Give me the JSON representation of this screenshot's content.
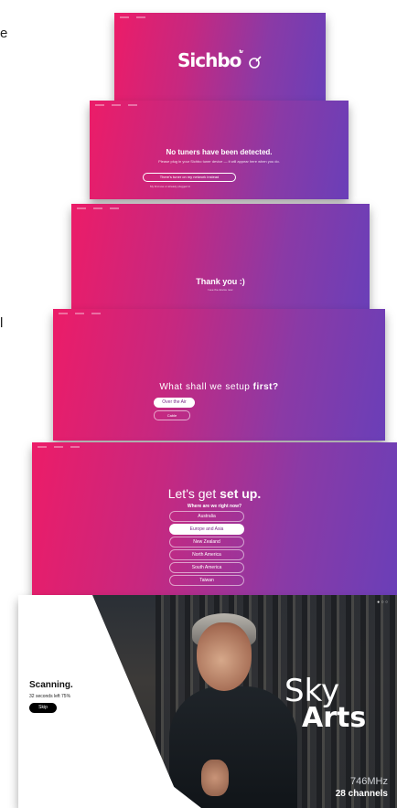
{
  "edge_text_top": "e",
  "edge_text_mid": "l",
  "screens": {
    "s1": {
      "logo_main": "Sichbo",
      "logo_badge": "tv",
      "logo_icon": "satellite-dish-icon"
    },
    "s2": {
      "heading": "No tuners have been detected.",
      "body": "Please plug in your Sichbo tuner device — it will appear here when you do.",
      "button": "There's tuner on my network instead",
      "link": "My first use or already plugged in"
    },
    "s3": {
      "heading": "Thank you :)",
      "body": "I see the device now."
    },
    "s4": {
      "heading_plain": "What shall we setup ",
      "heading_bold": "first?",
      "options": [
        "Over the Air",
        "Cable"
      ]
    },
    "s5": {
      "heading_plain": "Let's get ",
      "heading_bold": "set up.",
      "question": "Where are we right now?",
      "regions": [
        "Australia",
        "Europe and Asia",
        "New Zealand",
        "North America",
        "South America",
        "Taiwan"
      ],
      "selected": "Europe and Asia"
    },
    "s6": {
      "title": "Scanning.",
      "status": "32 seconds left 75%",
      "progress_percent": 75,
      "skip": "Skip",
      "channel_name_1": "Sky",
      "channel_name_2": "Arts",
      "frequency": "746MHz",
      "channels": "28 channels"
    }
  }
}
